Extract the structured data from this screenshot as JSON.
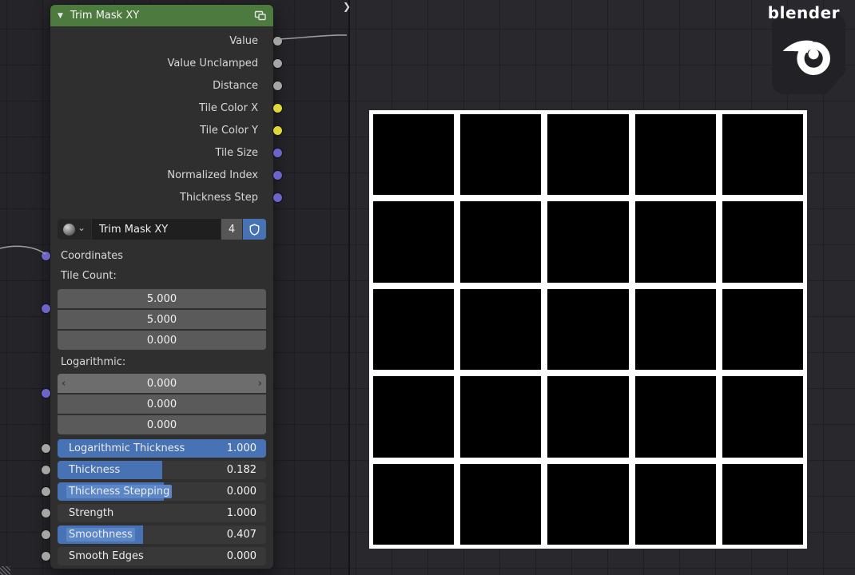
{
  "window": {
    "region_expand_arrow": "❯"
  },
  "branding": {
    "wordmark": "blender"
  },
  "node": {
    "title": "Trim Mask XY",
    "collapse_arrow": "▼",
    "colors": {
      "header_green": "#4d7a3e",
      "accent_blue": "#4772b3",
      "accent_blue_light": "#5b86c7",
      "socket_gray": "#a5a5a5",
      "socket_yellow": "#e0d83a",
      "socket_vector": "#6b64c9"
    },
    "outputs": [
      {
        "label": "Value",
        "color": "#a5a5a5"
      },
      {
        "label": "Value Unclamped",
        "color": "#a5a5a5"
      },
      {
        "label": "Distance",
        "color": "#a5a5a5"
      },
      {
        "label": "Tile Color X",
        "color": "#e0d83a"
      },
      {
        "label": "Tile Color Y",
        "color": "#e0d83a"
      },
      {
        "label": "Tile Size",
        "color": "#6b64c9"
      },
      {
        "label": "Normalized Index",
        "color": "#6b64c9"
      },
      {
        "label": "Thickness Step",
        "color": "#6b64c9"
      }
    ],
    "group_selector": {
      "name": "Trim Mask XY",
      "users": "4"
    },
    "coordinates_label": "Coordinates",
    "tile_count": {
      "label": "Tile Count:",
      "values": [
        "5.000",
        "5.000",
        "0.000"
      ]
    },
    "logarithmic": {
      "label": "Logarithmic:",
      "values": [
        "0.000",
        "0.000",
        "0.000"
      ]
    },
    "sliders": [
      {
        "label": "Logarithmic Thickness",
        "value": "1.000",
        "fill_width": "100%"
      },
      {
        "label": "Thickness",
        "value": "0.182",
        "fill_width": "50%"
      },
      {
        "label": "Thickness Stepping",
        "value": "0.000",
        "fill_width": "51%"
      },
      {
        "label": "Strength",
        "value": "1.000",
        "fill_width": "0%"
      },
      {
        "label": "Smoothness",
        "value": "0.407",
        "fill_width": "41%"
      },
      {
        "label": "Smooth Edges",
        "value": "0.000",
        "fill_width": "0%"
      }
    ]
  },
  "preview": {
    "rows": 5,
    "cols": 5,
    "tile_color": "#000000",
    "background": "#ffffff"
  }
}
